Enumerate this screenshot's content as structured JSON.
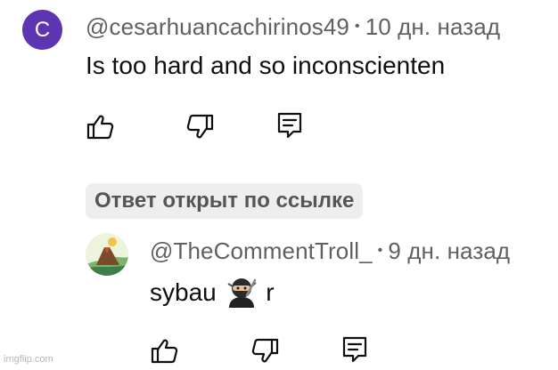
{
  "comment": {
    "avatar_letter": "C",
    "avatar_color": "#5e35b1",
    "author": "@cesarhuancachirinos49",
    "separator": "•",
    "time": "10 дн. назад",
    "text": "Is too hard and so inconscienten"
  },
  "reply_chip": {
    "label": "Ответ открыт по ссылке"
  },
  "reply": {
    "author": "@TheCommentTroll_",
    "separator": "•",
    "time": "9 дн. назад",
    "text_before": "sybau",
    "emoji_icon": "ninja-emoji-icon",
    "text_after": "r"
  },
  "actions": {
    "like_icon": "thumbs-up-icon",
    "dislike_icon": "thumbs-down-icon",
    "reply_icon": "reply-comment-icon"
  },
  "watermark": "imgflip.com"
}
